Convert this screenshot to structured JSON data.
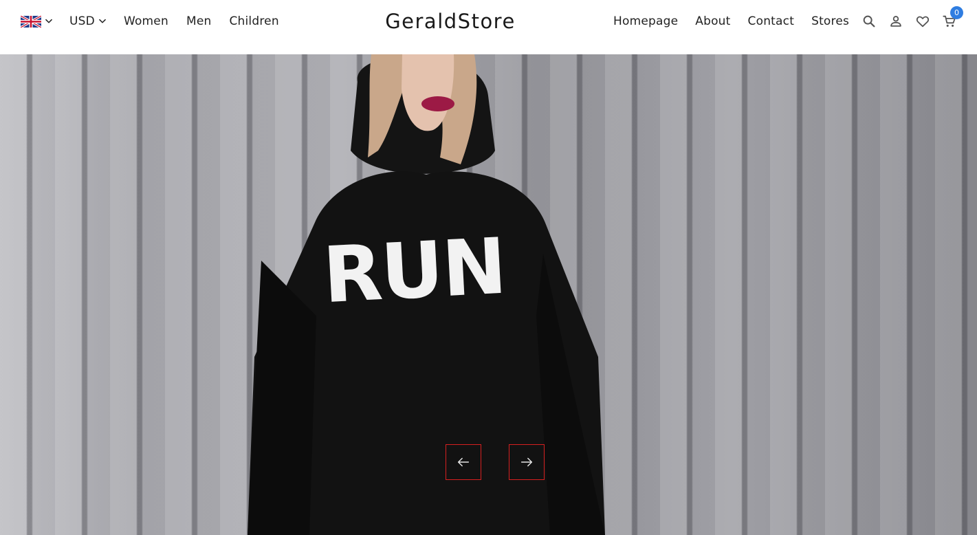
{
  "header": {
    "language": {
      "flag_icon": "uk-flag-icon",
      "chevron_icon": "chevron-down-icon"
    },
    "currency": {
      "label": "USD",
      "chevron_icon": "chevron-down-icon"
    },
    "left_links": [
      "Women",
      "Men",
      "Children"
    ],
    "brand": "GeraldStore",
    "right_links": [
      "Homepage",
      "About",
      "Contact",
      "Stores"
    ],
    "icons": [
      "search-icon",
      "user-icon",
      "heart-icon",
      "cart-icon"
    ],
    "cart_count": "0",
    "accent_color": "#2f7de1"
  },
  "hero": {
    "image": "woman-in-black-hoodie-photo",
    "shirt_text": "RUN",
    "prev_icon": "arrow-left-icon",
    "next_icon": "arrow-right-icon",
    "arrow_border_color": "#d72020"
  }
}
